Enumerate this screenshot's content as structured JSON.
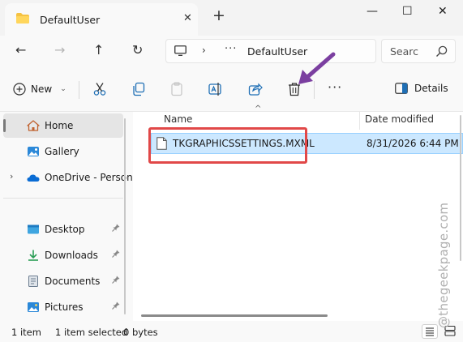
{
  "window": {
    "tab_title": "DefaultUser",
    "new_tab_glyph": "+",
    "close_tab_glyph": "✕",
    "minimize_glyph": "—",
    "maximize_glyph": "☐",
    "close_glyph": "✕"
  },
  "navigation": {
    "back_glyph": "←",
    "forward_glyph": "→",
    "up_glyph": "↑",
    "refresh_glyph": "↻",
    "address_chevron": "›",
    "address_overflow": "···",
    "address_current": "DefaultUser",
    "search_placeholder": "Searc"
  },
  "command_bar": {
    "new_label": "New",
    "new_chevron": "⌄",
    "more_glyph": "···",
    "details_label": "Details"
  },
  "sidebar": {
    "items": [
      {
        "label": "Home",
        "icon": "home-icon",
        "selected": true
      },
      {
        "label": "Gallery",
        "icon": "gallery-icon"
      },
      {
        "label": "OneDrive - Person",
        "icon": "onedrive-icon",
        "expandable": true
      },
      {
        "label": "Desktop",
        "icon": "desktop-icon",
        "pinned": true
      },
      {
        "label": "Downloads",
        "icon": "downloads-icon",
        "pinned": true
      },
      {
        "label": "Documents",
        "icon": "documents-icon",
        "pinned": true
      },
      {
        "label": "Pictures",
        "icon": "pictures-icon",
        "pinned": true
      }
    ],
    "expand_glyph": "›",
    "pin_glyph": "📌"
  },
  "file_list": {
    "columns": {
      "name": "Name",
      "date_modified": "Date modified"
    },
    "sort_glyph": "^",
    "rows": [
      {
        "name": "TKGRAPHICSSETTINGS.MXML",
        "date_modified": "8/31/2026 6:44 PM",
        "selected": true
      }
    ]
  },
  "status": {
    "item_count": "1 item",
    "selected_info": "1 item selected",
    "size": "0 bytes"
  },
  "watermark": "@thegeekpage.com",
  "colors": {
    "accent": "#0067c0",
    "selection": "#cce8ff",
    "highlight_box": "#e14848",
    "arrow": "#7b3fa0",
    "folder": "#f5c242"
  }
}
